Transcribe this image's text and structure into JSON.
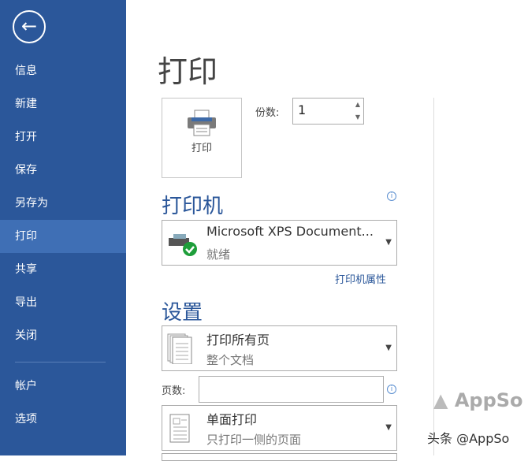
{
  "sidebar": {
    "back_icon": "arrow-left-icon",
    "items": [
      "信息",
      "新建",
      "打开",
      "保存",
      "另存为",
      "打印",
      "共享",
      "导出",
      "关闭",
      "帐户",
      "选项"
    ],
    "selected": "打印"
  },
  "main": {
    "title": "打印",
    "print_button": "打印",
    "copies_label": "份数:",
    "copies_value": "1",
    "printer_heading": "打印机",
    "printer_name": "Microsoft XPS Document...",
    "printer_status": "就绪",
    "printer_properties": "打印机属性",
    "settings_heading": "设置",
    "range_title": "打印所有页",
    "range_sub": "整个文档",
    "pages_label": "页数:",
    "pages_value": "",
    "sides_title": "单面打印",
    "sides_sub": "只打印一侧的页面"
  },
  "watermark": {
    "logo": "AppSo",
    "credit": "头条 @AppSo"
  },
  "colors": {
    "sidebar": "#2b579a",
    "selected": "#3f6fb5",
    "accent": "#2b579a"
  }
}
